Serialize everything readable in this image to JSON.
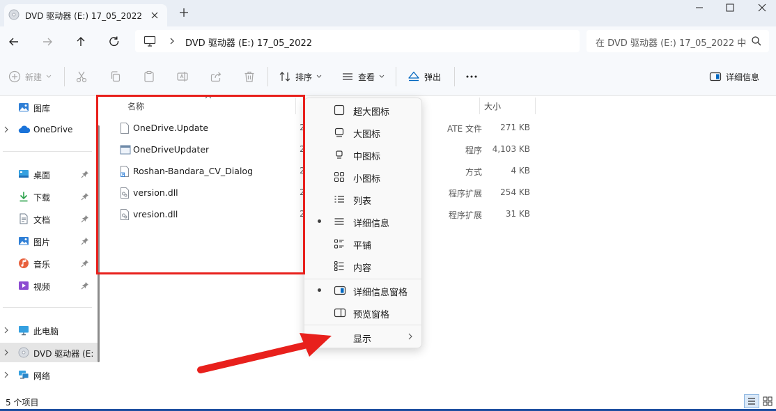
{
  "tab": {
    "title": "DVD 驱动器 (E:) 17_05_2022"
  },
  "address": {
    "path": "DVD 驱动器 (E:) 17_05_2022"
  },
  "search": {
    "placeholder": "在 DVD 驱动器 (E:) 17_05_2022 中"
  },
  "toolbar": {
    "new_label": "新建",
    "sort_label": "排序",
    "view_label": "查看",
    "eject_label": "弹出",
    "details_label": "详细信息"
  },
  "sidebar": {
    "items": [
      {
        "label": "图库",
        "icon": "gallery-icon"
      },
      {
        "label": "OneDrive",
        "icon": "cloud-icon"
      },
      {
        "label": "桌面",
        "icon": "desktop-icon"
      },
      {
        "label": "下载",
        "icon": "download-icon"
      },
      {
        "label": "文档",
        "icon": "document-icon"
      },
      {
        "label": "图片",
        "icon": "pictures-icon"
      },
      {
        "label": "音乐",
        "icon": "music-icon"
      },
      {
        "label": "视频",
        "icon": "video-icon"
      },
      {
        "label": "此电脑",
        "icon": "computer-icon"
      },
      {
        "label": "DVD 驱动器 (E:",
        "icon": "dvd-icon"
      },
      {
        "label": "网络",
        "icon": "network-icon"
      }
    ]
  },
  "filelist": {
    "columns": {
      "name": "名称",
      "size": "大小"
    },
    "rows": [
      {
        "name": "OneDrive.Update",
        "date": "2",
        "type": "ATE 文件",
        "size": "271 KB"
      },
      {
        "name": "OneDriveUpdater",
        "date": "2",
        "type": "程序",
        "size": "4,103 KB"
      },
      {
        "name": "Roshan-Bandara_CV_Dialog",
        "date": "2",
        "type": "方式",
        "size": "4 KB"
      },
      {
        "name": "version.dll",
        "date": "2",
        "type": "程序扩展",
        "size": "254 KB"
      },
      {
        "name": "vresion.dll",
        "date": "2",
        "type": "程序扩展",
        "size": "31 KB"
      }
    ]
  },
  "viewmenu": {
    "items": [
      {
        "label": "超大图标",
        "selected": false
      },
      {
        "label": "大图标",
        "selected": false
      },
      {
        "label": "中图标",
        "selected": false
      },
      {
        "label": "小图标",
        "selected": false
      },
      {
        "label": "列表",
        "selected": false
      },
      {
        "label": "详细信息",
        "selected": true
      },
      {
        "label": "平铺",
        "selected": false
      },
      {
        "label": "内容",
        "selected": false
      }
    ],
    "panes": [
      {
        "label": "详细信息窗格",
        "selected": true
      },
      {
        "label": "预览窗格",
        "selected": false
      }
    ],
    "show_label": "显示"
  },
  "status": {
    "item_count": "5 个项目"
  },
  "colors": {
    "accent": "#0067c0",
    "annotation": "#e8201c",
    "taskbar": "#1e4fa0"
  }
}
